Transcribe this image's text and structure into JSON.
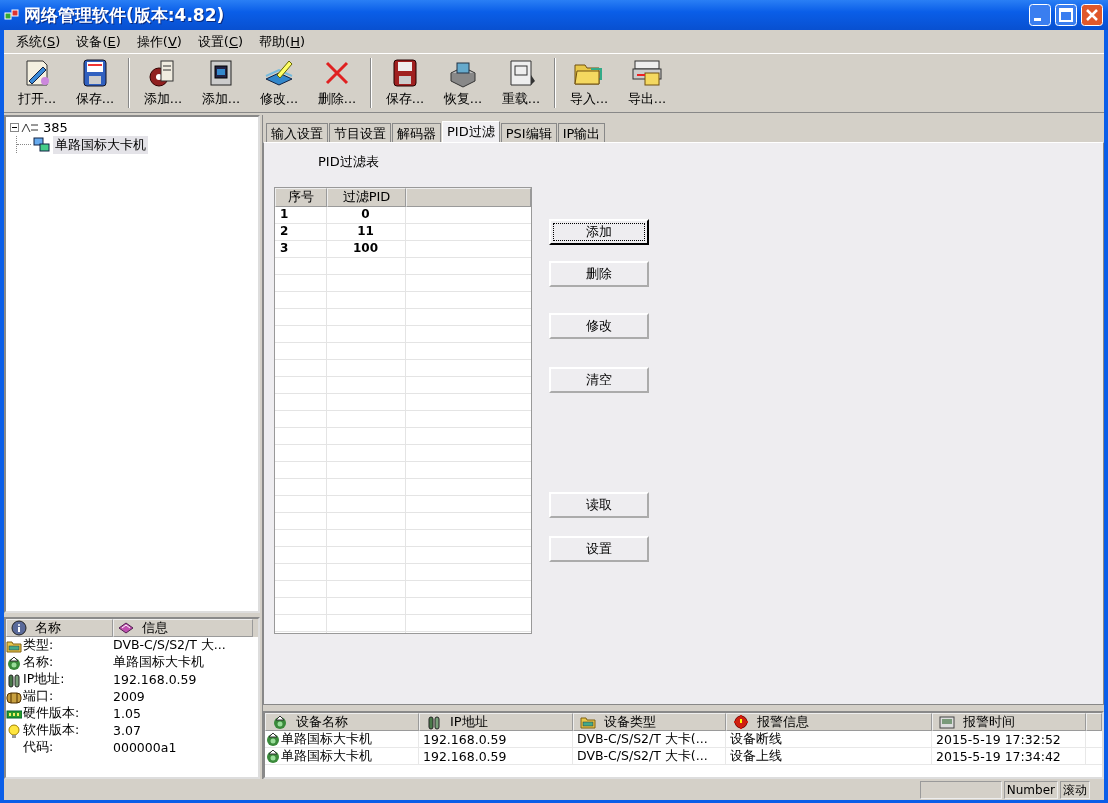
{
  "window": {
    "title": "网络管理软件(版本:4.82)"
  },
  "menu": [
    "系统(S)",
    "设备(E)",
    "操作(V)",
    "设置(C)",
    "帮助(H)"
  ],
  "toolbar": {
    "groups": [
      [
        "打开...",
        "保存..."
      ],
      [
        "添加...",
        "添加...",
        "修改...",
        "删除..."
      ],
      [
        "保存...",
        "恢复...",
        "重载..."
      ],
      [
        "导入...",
        "导出..."
      ]
    ]
  },
  "tree": [
    {
      "label": "385",
      "expanded": true,
      "selected": false,
      "children": [
        {
          "label": "单路国标大卡机",
          "selected": true
        }
      ]
    }
  ],
  "info": {
    "columns": [
      "名称",
      "信息"
    ],
    "rows": [
      [
        "类型:",
        "DVB-C/S/S2/T 大..."
      ],
      [
        "名称:",
        "单路国标大卡机"
      ],
      [
        "IP地址:",
        "192.168.0.59"
      ],
      [
        "端口:",
        "2009"
      ],
      [
        "硬件版本:",
        "1.05"
      ],
      [
        "软件版本:",
        "3.07"
      ],
      [
        "代码:",
        "000000a1"
      ]
    ]
  },
  "tabs": [
    {
      "label": "输入设置",
      "selected": false
    },
    {
      "label": "节目设置",
      "selected": false
    },
    {
      "label": "解码器",
      "selected": false
    },
    {
      "label": "PID过滤",
      "selected": true
    },
    {
      "label": "PSI编辑",
      "selected": false
    },
    {
      "label": "IP输出",
      "selected": false
    }
  ],
  "pid_filter": {
    "title": "PID过滤表",
    "columns": [
      "序号",
      "过滤PID"
    ],
    "rows": [
      [
        "1",
        "0"
      ],
      [
        "2",
        "11"
      ],
      [
        "3",
        "100"
      ]
    ]
  },
  "buttons": [
    {
      "label": "添加",
      "focused": true
    },
    {
      "label": "删除",
      "focused": false
    },
    {
      "label": "修改",
      "focused": false
    },
    {
      "label": "清空",
      "focused": false
    },
    {
      "label": "读取",
      "focused": false
    },
    {
      "label": "设置",
      "focused": false
    }
  ],
  "alarms": {
    "columns": [
      "设备名称",
      "IP地址",
      "设备类型",
      "报警信息",
      "报警时间"
    ],
    "rows": [
      [
        "单路国标大卡机",
        "192.168.0.59",
        "DVB-C/S/S2/T 大卡(...",
        "设备断线",
        "2015-5-19 17:32:52"
      ],
      [
        "单路国标大卡机",
        "192.168.0.59",
        "DVB-C/S/S2/T 大卡(...",
        "设备上线",
        "2015-5-19 17:34:42"
      ]
    ]
  },
  "status_bar": [
    "Number",
    "滚动"
  ]
}
